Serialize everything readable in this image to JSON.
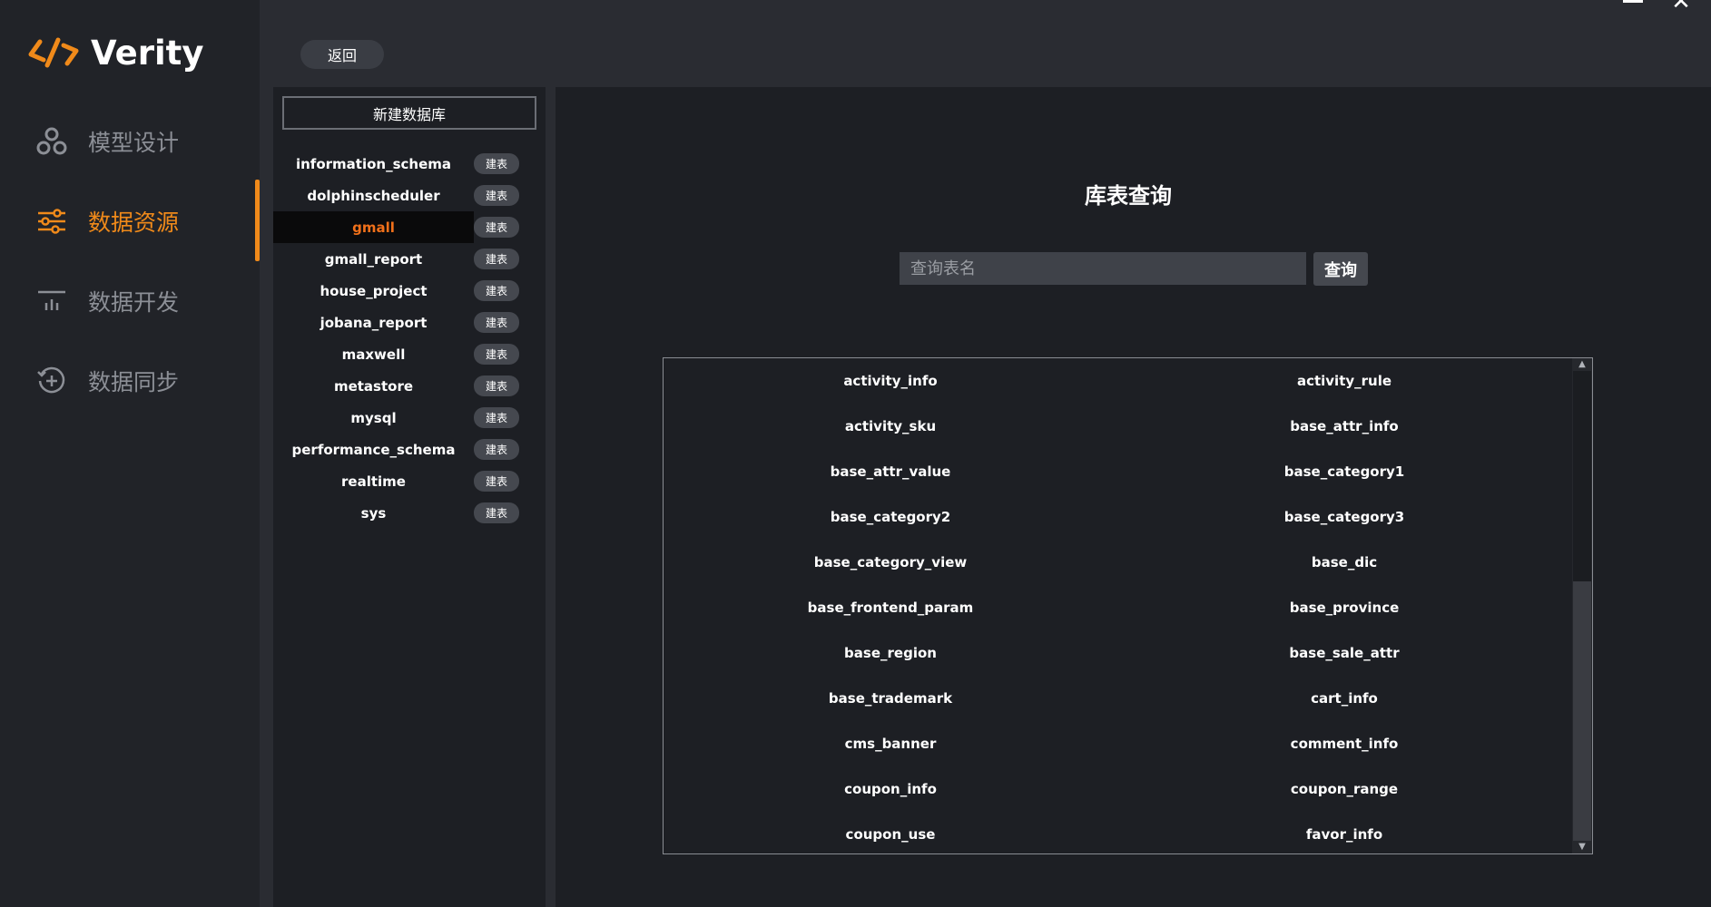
{
  "app": {
    "logo_text": "Verity",
    "accent_color": "#f08a1a"
  },
  "sidebar": {
    "items": [
      {
        "label": "模型设计",
        "icon": "model-design-icon",
        "active": false
      },
      {
        "label": "数据资源",
        "icon": "data-resource-icon",
        "active": true
      },
      {
        "label": "数据开发",
        "icon": "data-dev-icon",
        "active": false
      },
      {
        "label": "数据同步",
        "icon": "data-sync-icon",
        "active": false
      }
    ]
  },
  "topbar": {
    "back_label": "返回",
    "minimize_icon": "minimize-icon",
    "close_icon": "close-icon",
    "close_glyph": "✕"
  },
  "db_panel": {
    "new_db_label": "新建数据库",
    "build_label": "建表",
    "databases": [
      "information_schema",
      "dolphinscheduler",
      "gmall",
      "gmall_report",
      "house_project",
      "jobana_report",
      "maxwell",
      "metastore",
      "mysql",
      "performance_schema",
      "realtime",
      "sys"
    ],
    "selected": "gmall"
  },
  "main": {
    "title": "库表查询",
    "search_placeholder": "查询表名",
    "search_button": "查询",
    "tables": [
      [
        "activity_info",
        "activity_rule"
      ],
      [
        "activity_sku",
        "base_attr_info"
      ],
      [
        "base_attr_value",
        "base_category1"
      ],
      [
        "base_category2",
        "base_category3"
      ],
      [
        "base_category_view",
        "base_dic"
      ],
      [
        "base_frontend_param",
        "base_province"
      ],
      [
        "base_region",
        "base_sale_attr"
      ],
      [
        "base_trademark",
        "cart_info"
      ],
      [
        "cms_banner",
        "comment_info"
      ],
      [
        "coupon_info",
        "coupon_range"
      ],
      [
        "coupon_use",
        "favor_info"
      ]
    ]
  }
}
